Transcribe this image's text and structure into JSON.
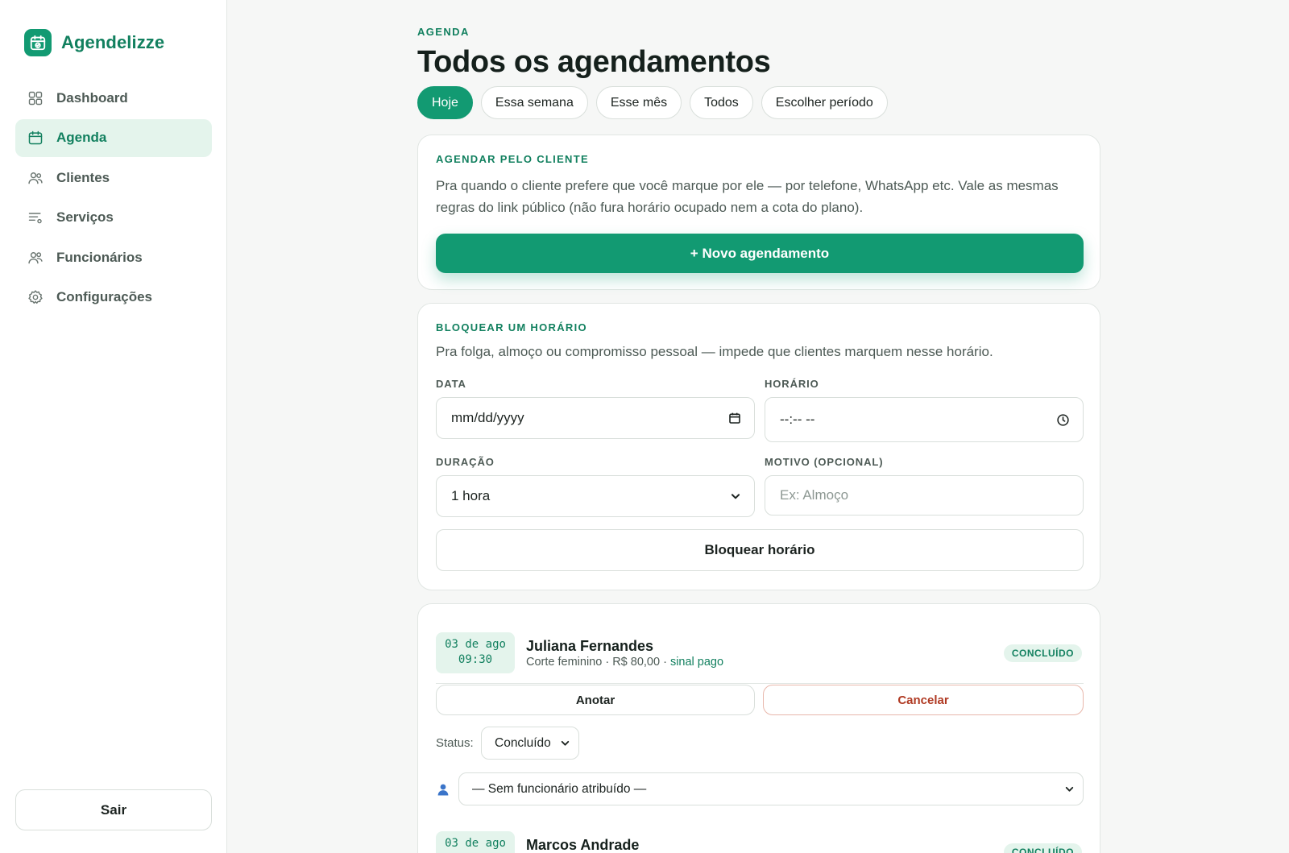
{
  "app": {
    "name": "Agendelizze"
  },
  "sidebar": {
    "items": [
      {
        "label": "Dashboard",
        "icon": "grid-icon"
      },
      {
        "label": "Agenda",
        "icon": "calendar-icon",
        "active": true
      },
      {
        "label": "Clientes",
        "icon": "users-icon"
      },
      {
        "label": "Serviços",
        "icon": "list-settings-icon"
      },
      {
        "label": "Funcionários",
        "icon": "team-icon"
      },
      {
        "label": "Configurações",
        "icon": "gear-icon"
      }
    ],
    "logout_label": "Sair"
  },
  "header": {
    "eyebrow": "AGENDA",
    "title": "Todos os agendamentos"
  },
  "filters": [
    {
      "label": "Hoje",
      "active": true
    },
    {
      "label": "Essa semana"
    },
    {
      "label": "Esse mês"
    },
    {
      "label": "Todos"
    },
    {
      "label": "Escolher período"
    }
  ],
  "book_card": {
    "label": "AGENDAR PELO CLIENTE",
    "description": "Pra quando o cliente prefere que você marque por ele — por telefone, WhatsApp etc. Vale as mesmas regras do link público (não fura horário ocupado nem a cota do plano).",
    "button": "+ Novo agendamento"
  },
  "block_card": {
    "label": "BLOQUEAR UM HORÁRIO",
    "description": "Pra folga, almoço ou compromisso pessoal — impede que clientes marquem nesse horário.",
    "date_label": "DATA",
    "date_placeholder": "mm/dd/yyyy",
    "time_label": "HORÁRIO",
    "time_placeholder": "--:-- --",
    "duration_label": "DURAÇÃO",
    "duration_value": "1 hora",
    "reason_label": "MOTIVO (OPCIONAL)",
    "reason_placeholder": "Ex: Almoço",
    "button": "Bloquear horário"
  },
  "appointments": [
    {
      "date": "03 de ago",
      "time": "09:30",
      "client": "Juliana Fernandes",
      "service": "Corte feminino",
      "price": "R$ 80,00",
      "deposit": "sinal pago",
      "badge": "CONCLUÍDO",
      "note_button": "Anotar",
      "cancel_button": "Cancelar",
      "status_label": "Status:",
      "status_value": "Concluído",
      "staff_value": "— Sem funcionário atribuído —"
    },
    {
      "date": "03 de ago",
      "client": "Marcos Andrade",
      "badge": "CONCLUÍDO"
    }
  ],
  "colors": {
    "accent": "#129a72",
    "accent_dark": "#12805f",
    "accent_soft": "#e4f4ec",
    "danger": "#b03a23"
  }
}
